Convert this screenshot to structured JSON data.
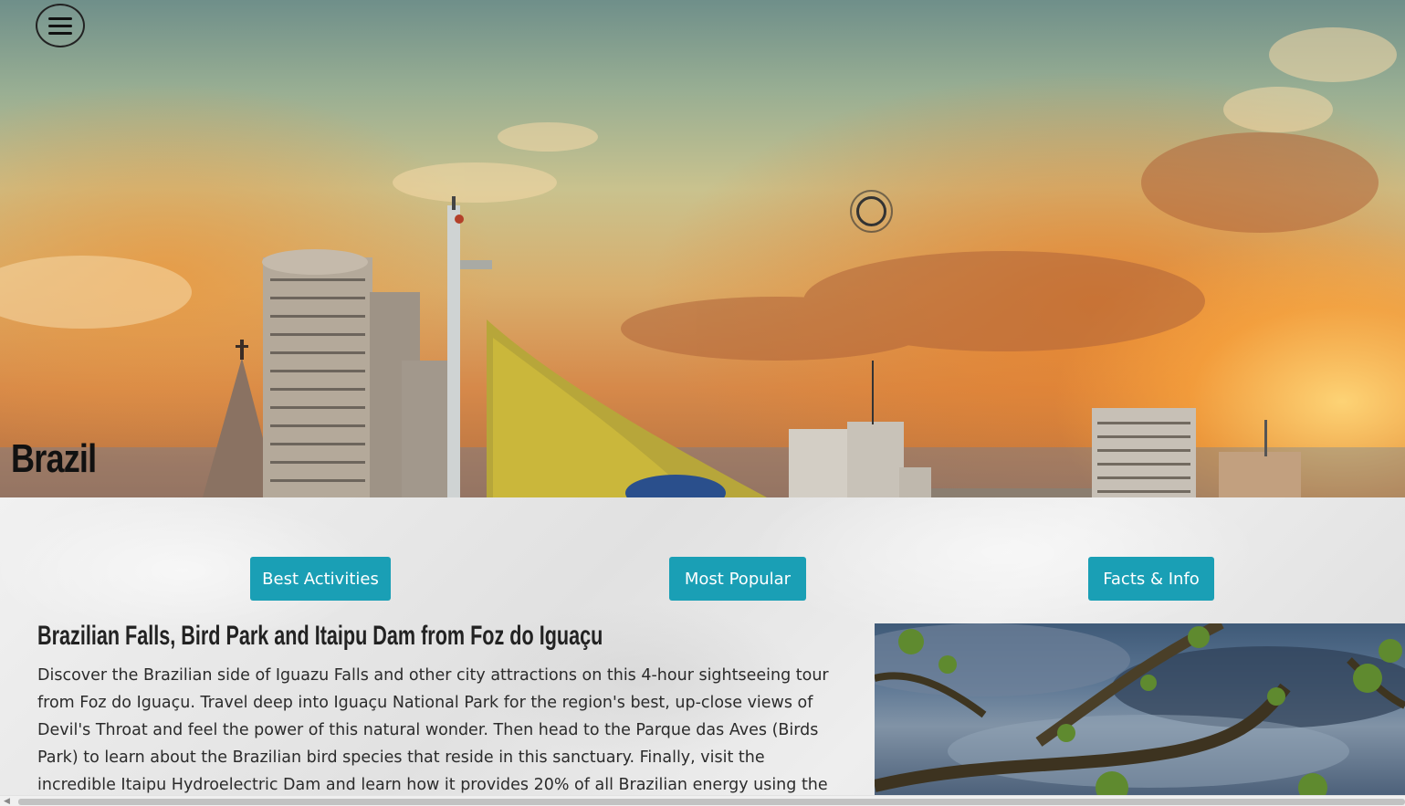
{
  "hero": {
    "title": "Brazil",
    "menu_icon": "hamburger-menu-icon",
    "loader_icon": "loading-ring-icon"
  },
  "tabs": [
    {
      "label": "Best Activities"
    },
    {
      "label": "Most Popular"
    },
    {
      "label": "Facts & Info"
    }
  ],
  "article": {
    "title": "Brazilian Falls, Bird Park and Itaipu Dam from Foz do Iguaçu",
    "body": "Discover the Brazilian side of Iguazu Falls and other city attractions on this 4-hour sightseeing tour from Foz do Iguaçu. Travel deep into Iguaçu National Park for the region's best, up-close views of Devil's Throat and feel the power of this natural wonder. Then head to the Parque das Aves (Birds Park) to learn about the Brazilian bird species that reside in this sanctuary. Finally, visit the incredible Itaipu Hydroelectric Dam and learn how it provides 20% of all Brazilian energy using the"
  },
  "colors": {
    "button_bg": "#1a9fb5",
    "button_text": "#ffffff",
    "title_text": "#111111",
    "body_text": "#2b2b2b"
  }
}
